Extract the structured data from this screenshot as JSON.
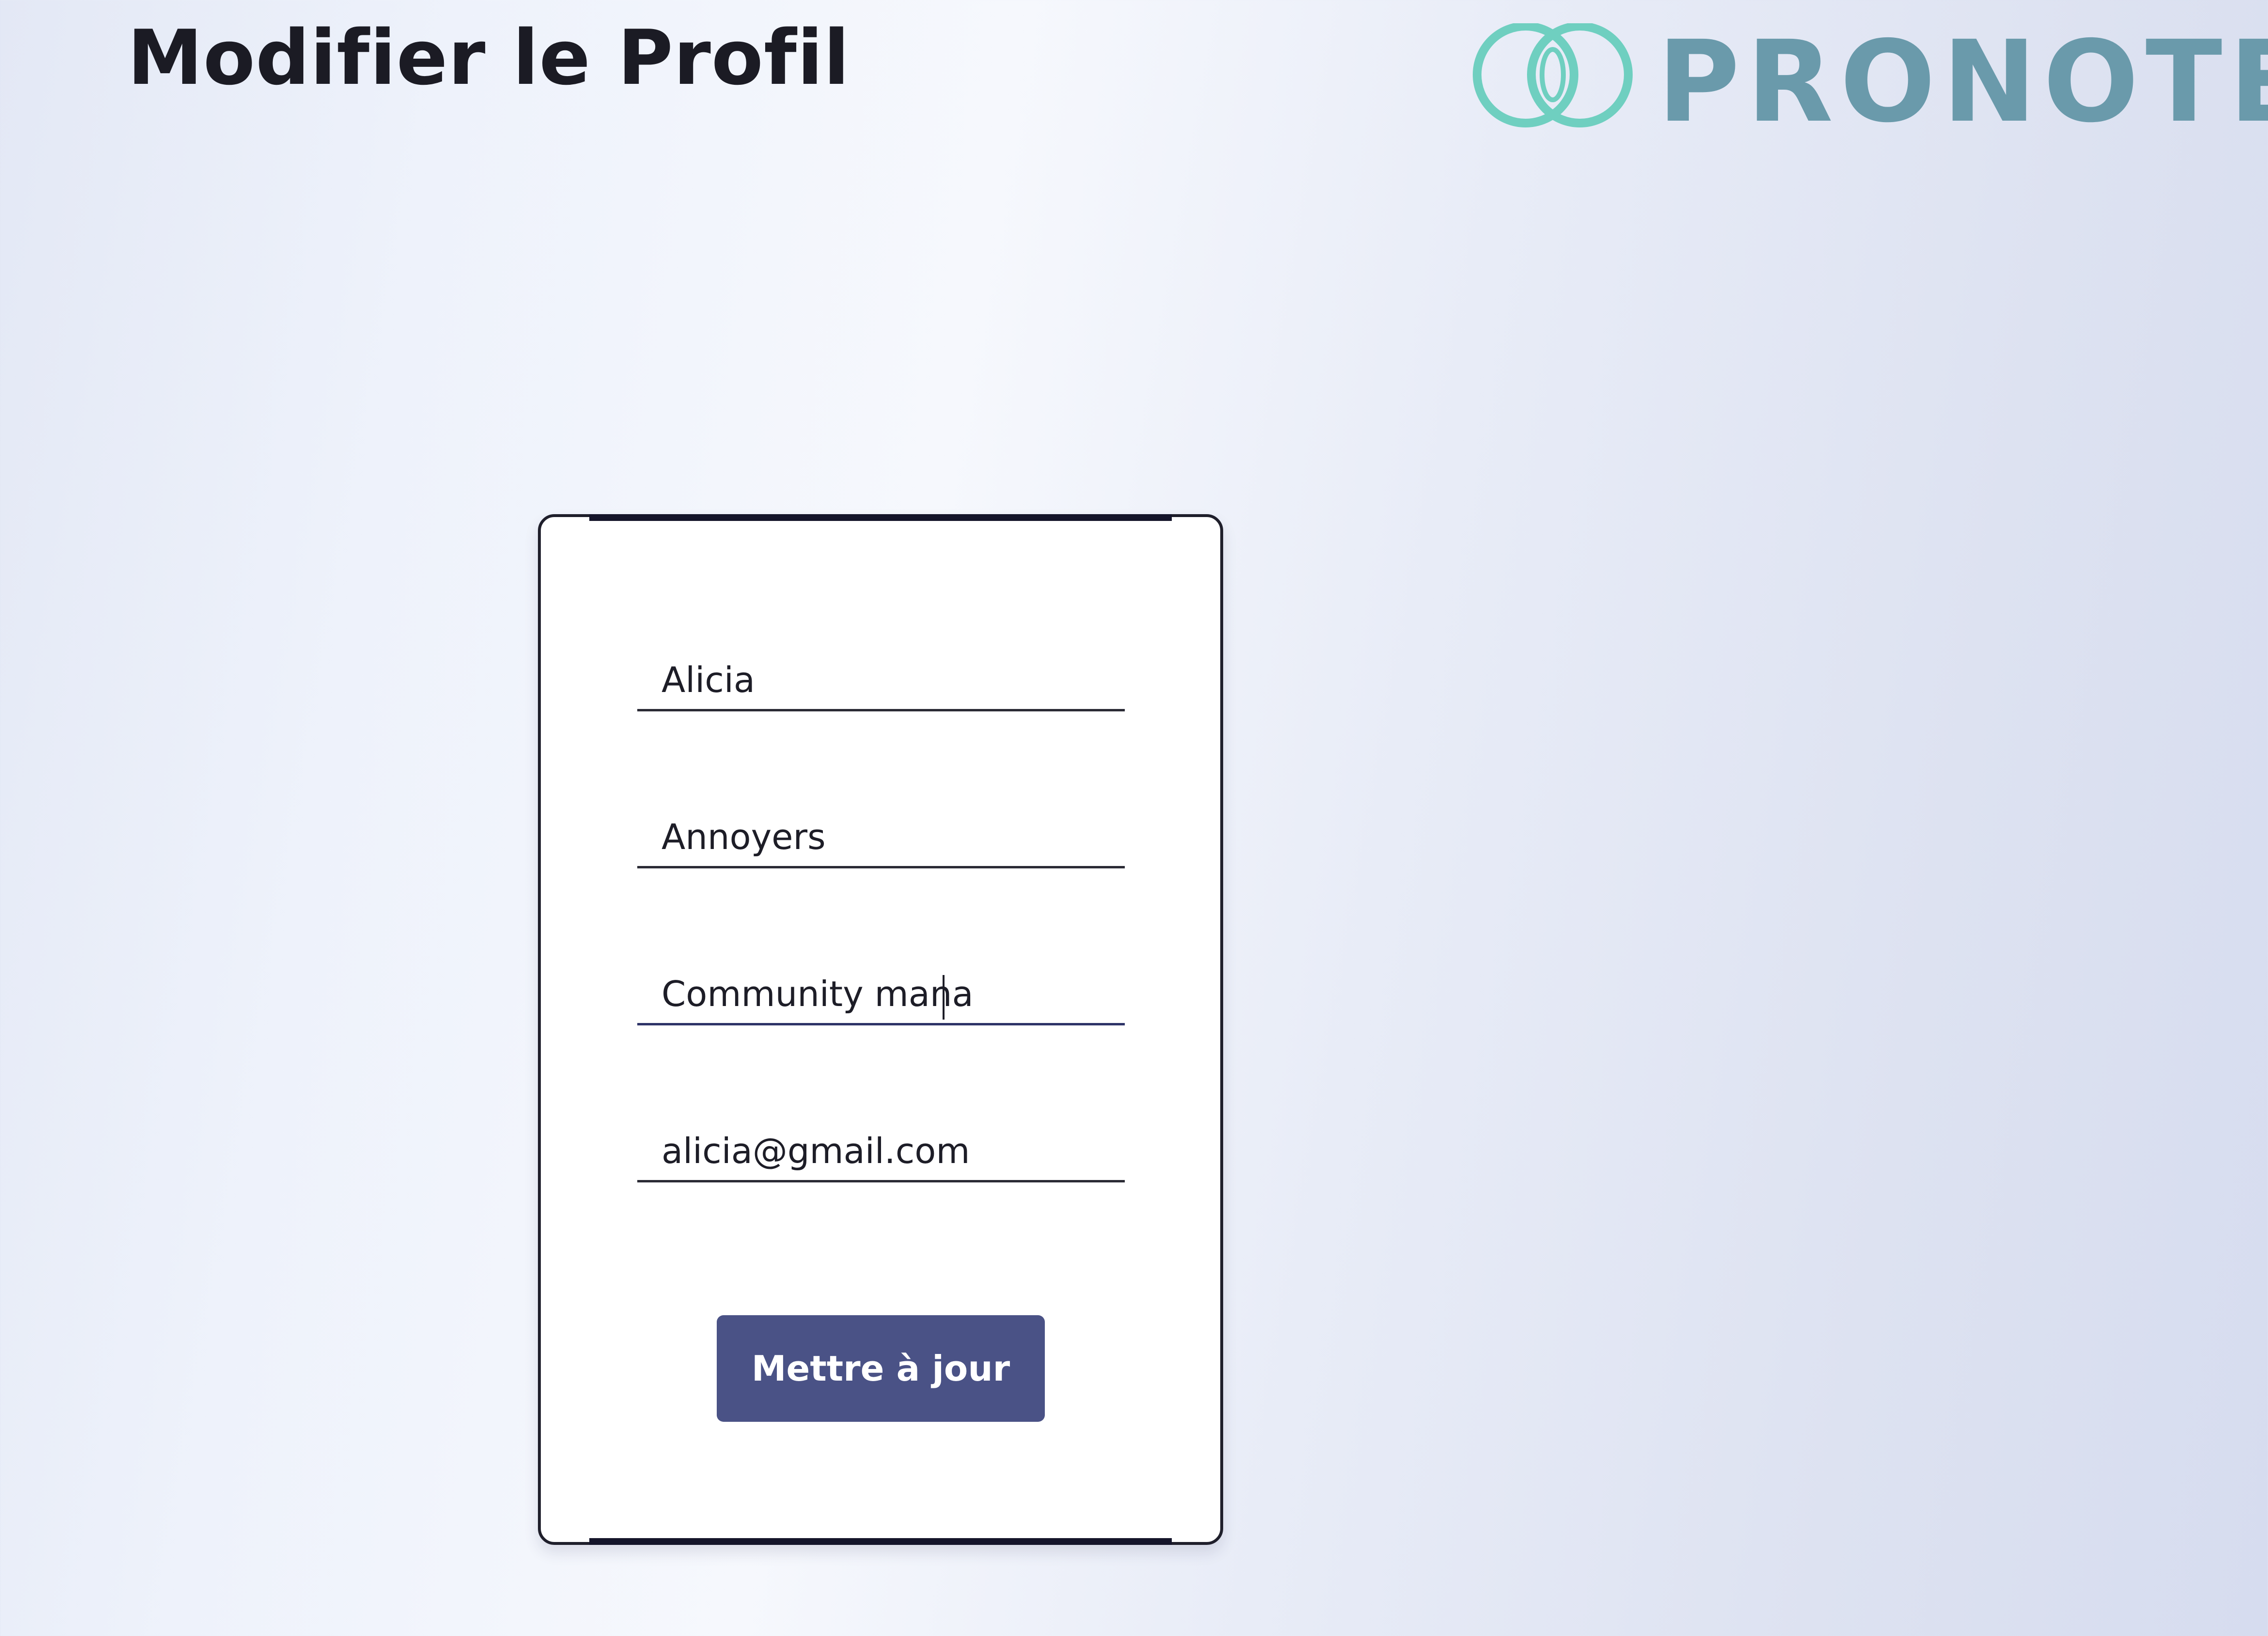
{
  "page": {
    "title": "Modifier le Profil"
  },
  "logo": {
    "text": "PRONOTE",
    "icon": "interlocking-rings-icon",
    "colors": {
      "rings": "#6fcfc0",
      "text": "#6a9aab"
    }
  },
  "form": {
    "fields": [
      {
        "name": "first-name",
        "value": "Alicia"
      },
      {
        "name": "last-name",
        "value": "Annoyers"
      },
      {
        "name": "job-title",
        "value": "Community mana",
        "focused": true
      },
      {
        "name": "email",
        "value": "alicia@gmail.com"
      }
    ],
    "submit_label": "Mettre à jour"
  },
  "colors": {
    "button": "#4a5286",
    "button_text": "#ffffff",
    "title": "#1b1b24",
    "card_border": "#1f1f2b"
  }
}
